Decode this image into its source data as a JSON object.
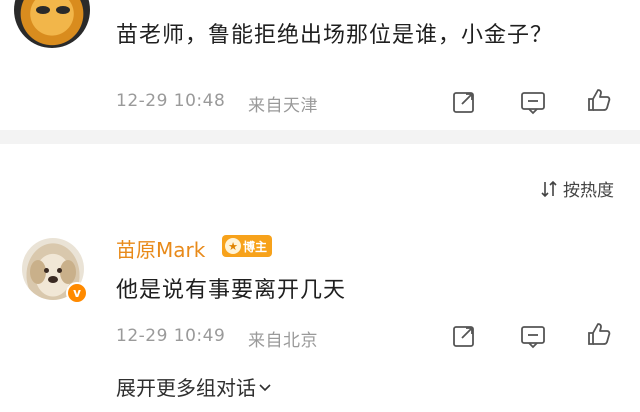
{
  "comment_top": {
    "username_partial": "",
    "text": "苗老师，鲁能拒绝出场那位是谁，小金子？",
    "time": "12-29 10:48",
    "location": "来自天津"
  },
  "sort": {
    "label": "按热度",
    "icon": "sort-icon"
  },
  "comment_main": {
    "username": "苗原Mark",
    "badge_label": "博主",
    "verified_icon": "v-badge-icon",
    "text": "他是说有事要离开几天",
    "time": "12-29 10:49",
    "location": "来自北京"
  },
  "expand": {
    "label": "展开更多组对话"
  },
  "colors": {
    "username": "#e88a1a",
    "badge_bg": "#f7a21b",
    "meta": "#9a9a9a",
    "divider": "#f3f3f3"
  }
}
